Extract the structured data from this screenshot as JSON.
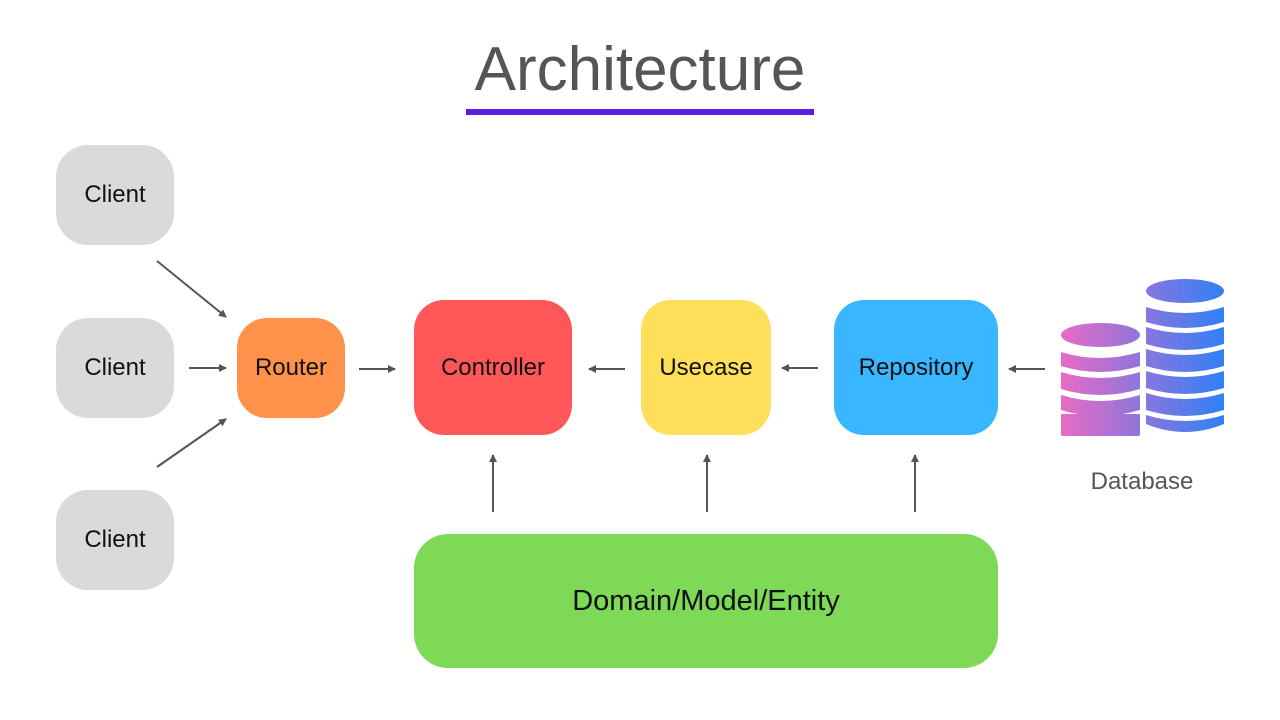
{
  "title": "Architecture",
  "colors": {
    "title_text": "#555555",
    "title_underline": "#5b1ee8",
    "client": "#dadada",
    "router": "#ff924b",
    "controller": "#ff5757",
    "usecase": "#ffde59",
    "repository": "#38b6ff",
    "domain": "#7ed957",
    "arrow": "#555555",
    "database_gradient": [
      "#e96bc3",
      "#2f80f7"
    ]
  },
  "nodes": {
    "clients": [
      {
        "label": "Client"
      },
      {
        "label": "Client"
      },
      {
        "label": "Client"
      }
    ],
    "router": {
      "label": "Router"
    },
    "controller": {
      "label": "Controller"
    },
    "usecase": {
      "label": "Usecase"
    },
    "repository": {
      "label": "Repository"
    },
    "domain": {
      "label": "Domain/Model/Entity"
    },
    "database": {
      "label": "Database",
      "icon": "database-stack-icon"
    }
  },
  "edges": [
    {
      "from": "Client (top)",
      "to": "Router"
    },
    {
      "from": "Client (middle)",
      "to": "Router"
    },
    {
      "from": "Client (bottom)",
      "to": "Router"
    },
    {
      "from": "Router",
      "to": "Controller"
    },
    {
      "from": "Usecase",
      "to": "Controller"
    },
    {
      "from": "Repository",
      "to": "Usecase"
    },
    {
      "from": "Database",
      "to": "Repository"
    },
    {
      "from": "Domain/Model/Entity",
      "to": "Controller"
    },
    {
      "from": "Domain/Model/Entity",
      "to": "Usecase"
    },
    {
      "from": "Domain/Model/Entity",
      "to": "Repository"
    }
  ]
}
